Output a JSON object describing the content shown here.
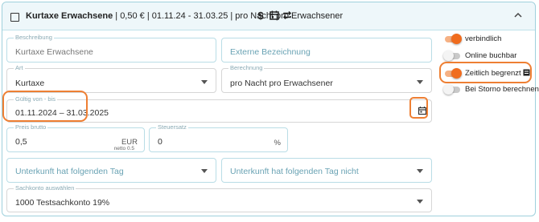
{
  "header": {
    "title": "Kurtaxe Erwachsene",
    "details": " | 0,50 € | 01.11.24 - 31.03.25 | pro Nacht pro Erwachsener",
    "icons": [
      "dollar-icon",
      "calendar-icon",
      "repeat-icon",
      "chevron-up-icon"
    ]
  },
  "form": {
    "beschreibung": {
      "label": "Beschreibung",
      "value": "Kurtaxe Erwachsene"
    },
    "externe": {
      "placeholder": "Externe Bezeichnung"
    },
    "art": {
      "label": "Art",
      "value": "Kurtaxe"
    },
    "berechnung": {
      "label": "Berechnung",
      "value": "pro Nacht pro Erwachsener"
    },
    "gueltig": {
      "label": "Gültig von - bis",
      "value": "01.11.2024 – 31.03.2025"
    },
    "preis": {
      "label": "Preis brutto",
      "value": "0,5",
      "suffix": "EUR",
      "hint": "netto 0.5"
    },
    "steuersatz": {
      "label": "Steuersatz",
      "value": "0",
      "suffix": "%"
    },
    "unterkunft_tag": {
      "placeholder": "Unterkunft hat folgenden Tag"
    },
    "unterkunft_tag_nicht": {
      "placeholder": "Unterkunft hat folgenden Tag nicht"
    },
    "sachkonto": {
      "label": "Sachkonto auswählen",
      "value": "1000 Testsachkonto 19%"
    }
  },
  "toggles": [
    {
      "label": "verbindlich",
      "on": true
    },
    {
      "label": "Online buchbar",
      "on": false
    },
    {
      "label": "Zeitlich begrenzt",
      "on": true
    },
    {
      "label": "Bei Storno berechnen",
      "on": false
    }
  ],
  "colors": {
    "accent": "#f06c1e",
    "border": "#b9dde6",
    "header_bg": "#eef7fa",
    "highlight": "#ee7f33"
  }
}
